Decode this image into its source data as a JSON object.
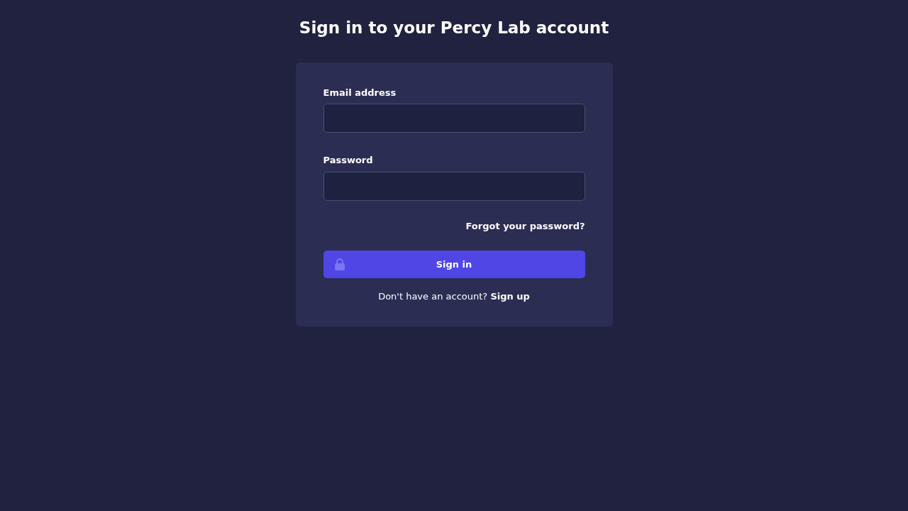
{
  "title": "Sign in to your Percy Lab account",
  "fields": [
    {
      "label": "Email address"
    },
    {
      "label": "Password"
    }
  ],
  "forgot_link": "Forgot your password?",
  "submit_button": {
    "label": "Sign in"
  },
  "signup": {
    "prompt": "Don't have an account?",
    "link": "Sign up"
  }
}
